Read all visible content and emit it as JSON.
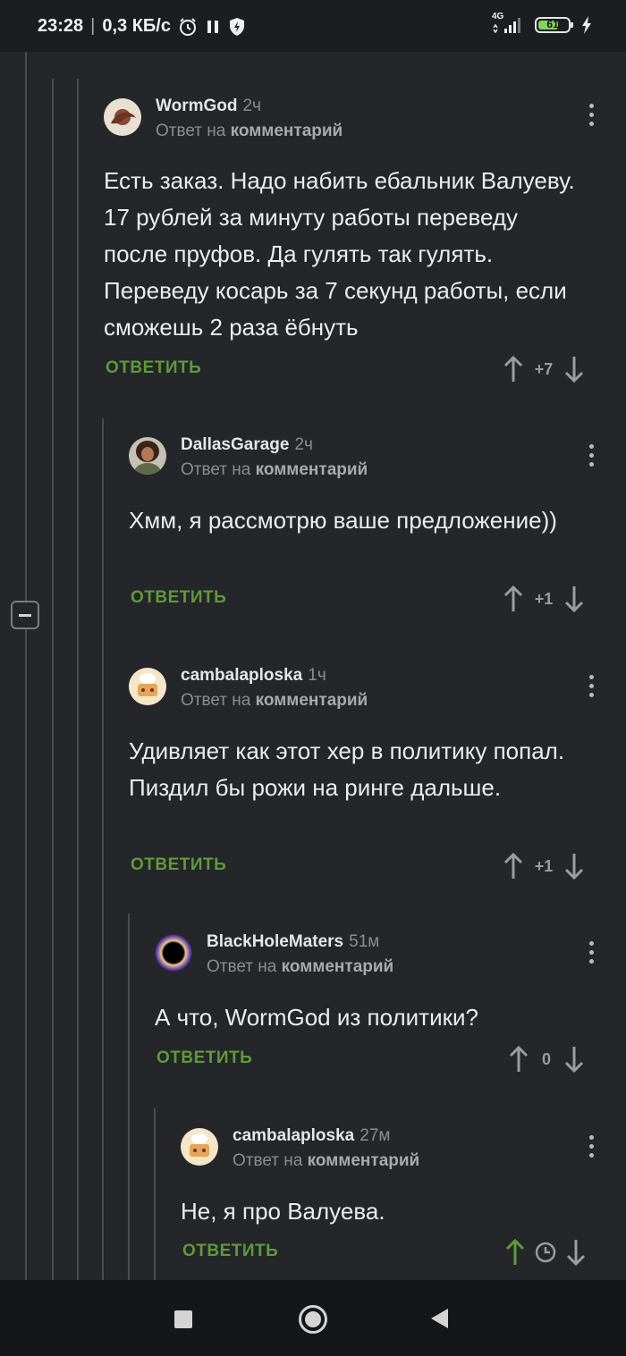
{
  "status_bar": {
    "time": "23:28",
    "speed": "0,3 КБ/с",
    "network": "4G",
    "battery": "61",
    "icons": [
      "alarm-icon",
      "pause-icon",
      "shield-icon",
      "signal-icon",
      "battery-icon",
      "charging-icon"
    ]
  },
  "comments": [
    {
      "user": "WormGod",
      "time": "2ч",
      "reply_prefix": "Ответ на",
      "reply_target": "комментарий",
      "text": "Есть заказ. Надо набить ебальник Валуеву. 17 рублей за минуту работы переведу после пруфов. Да гулять так гулять. Переведу косарь за 7 секунд работы, если сможешь 2 раза ёбнуть",
      "reply_label": "ОТВЕТИТЬ",
      "score": "+7"
    },
    {
      "user": "DallasGarage",
      "time": "2ч",
      "reply_prefix": "Ответ на",
      "reply_target": "комментарий",
      "text": "Хмм, я рассмотрю ваше предложение))",
      "reply_label": "ОТВЕТИТЬ",
      "score": "+1"
    },
    {
      "user": "cambalaploska",
      "time": "1ч",
      "reply_prefix": "Ответ на",
      "reply_target": "комментарий",
      "text": "Удивляет как этот хер в политику попал. Пиздил бы рожи на ринге дальше.",
      "reply_label": "ОТВЕТИТЬ",
      "score": "+1"
    },
    {
      "user": "BlackHoleMaters",
      "time": "51м",
      "reply_prefix": "Ответ на",
      "reply_target": "комментарий",
      "text": "А что, WormGod из политики?",
      "reply_label": "ОТВЕТИТЬ",
      "score": "0"
    },
    {
      "user": "cambalaploska",
      "time": "27м",
      "reply_prefix": "Ответ на",
      "reply_target": "комментарий",
      "text": "Не, я про Валуева.",
      "reply_label": "ОТВЕТИТЬ",
      "score_icon": "clock-icon"
    }
  ],
  "colors": {
    "background": "#24262a",
    "reply_green": "#5f9a39",
    "upvoted_green": "#5f9a39"
  }
}
